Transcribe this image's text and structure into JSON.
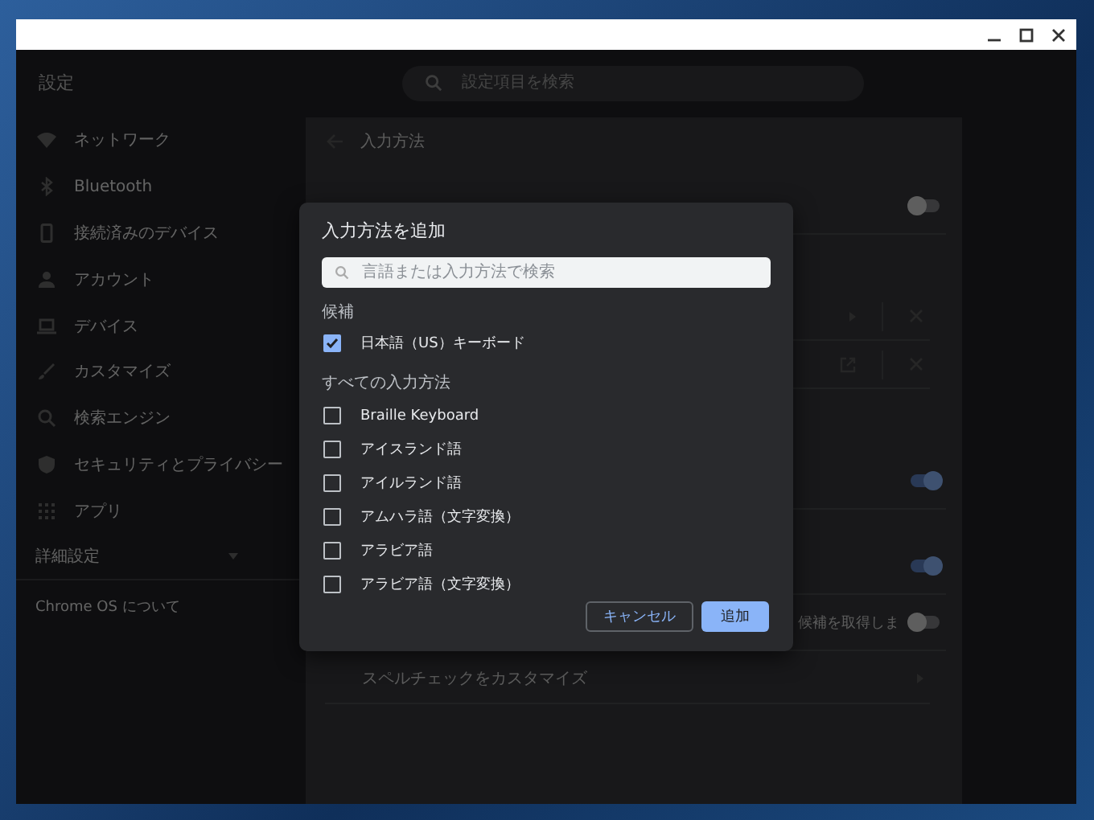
{
  "header": {
    "title": "設定",
    "search": {
      "placeholder": "設定項目を検索"
    }
  },
  "sidebar": {
    "items": [
      {
        "label": "ネットワーク",
        "kind": "wifi"
      },
      {
        "label": "Bluetooth",
        "kind": "bluetooth"
      },
      {
        "label": "接続済みのデバイス",
        "kind": "phone"
      },
      {
        "label": "アカウント",
        "kind": "person"
      },
      {
        "label": "デバイス",
        "kind": "laptop"
      },
      {
        "label": "カスタマイズ",
        "kind": "brush"
      },
      {
        "label": "検索エンジン",
        "kind": "search"
      },
      {
        "label": "セキュリティとプライバシー",
        "kind": "shield"
      },
      {
        "label": "アプリ",
        "kind": "apps"
      }
    ],
    "advanced": {
      "label": "詳細設定",
      "expanded": false
    },
    "about": "Chrome OS について"
  },
  "page": {
    "title": "入力方法",
    "rows": [
      {
        "kind": "toggle",
        "on": false
      },
      {
        "kind": "arrow"
      },
      {
        "kind": "external"
      },
      {
        "kind": "toggle",
        "on": true
      },
      {
        "kind": "toggle",
        "on": true
      },
      {
        "kind": "toggle",
        "on": false,
        "label": "候補を取得しま"
      },
      {
        "kind": "link",
        "label": "スペルチェックをカスタマイズ"
      }
    ]
  },
  "dialog": {
    "title": "入力方法を追加",
    "search": {
      "placeholder": "言語または入力方法で検索"
    },
    "suggested_heading": "候補",
    "suggested": [
      {
        "label": "日本語（US）キーボード",
        "checked": true
      }
    ],
    "all_heading": "すべての入力方法",
    "all": [
      {
        "label": "Braille Keyboard",
        "checked": false
      },
      {
        "label": "アイスランド語",
        "checked": false
      },
      {
        "label": "アイルランド語",
        "checked": false
      },
      {
        "label": "アムハラ語（文字変換）",
        "checked": false
      },
      {
        "label": "アラビア語",
        "checked": false
      },
      {
        "label": "アラビア語（文字変換）",
        "checked": false
      }
    ],
    "buttons": [
      {
        "label": "キャンセル",
        "kind": "secondary"
      },
      {
        "label": "追加",
        "kind": "primary"
      }
    ]
  }
}
